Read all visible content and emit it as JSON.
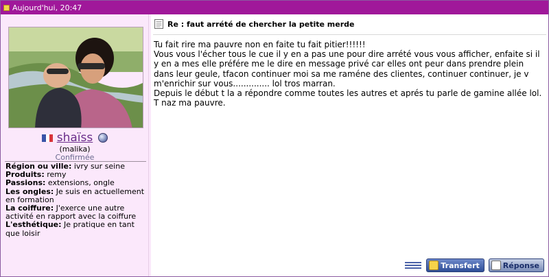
{
  "post": {
    "date": "Aujourd'hui, 20:47",
    "title": "Re : faut arrété de chercher la petite merde",
    "body": "Tu fait rire ma pauvre non en faite tu fait pitier!!!!!!\nVous vous l'écher tous le cue il y en a pas une pour dire arrété vous vous afficher, enfaite si il y en a mes elle préfére me le dire en message privé car elles ont peur dans prendre plein dans leur geule, tfacon continuer moi sa me raméne des clientes, continuer continuer, je v m'enrichir sur vous.............. lol tros marran.\nDepuis le début t la a répondre comme toutes les autres et aprés tu parle de gamine allée lol.\nT naz ma pauvre."
  },
  "author": {
    "username": "shaïss",
    "real_name": "(malika)",
    "rank": "Confirmée",
    "flag_icon": "france-flag-icon",
    "status_icon": "status-orb-icon",
    "fields": [
      {
        "label": "Région ou ville:",
        "value": " ivry sur seine"
      },
      {
        "label": "Produits:",
        "value": " remy"
      },
      {
        "label": "Passions:",
        "value": " extensions, ongle"
      },
      {
        "label": "Les ongles:",
        "value": " Je suis en actuellement en formation"
      },
      {
        "label": "La coiffure:",
        "value": " J'exerce une autre activité en rapport avec la coiffure"
      },
      {
        "label": "L'esthétique:",
        "value": " Je pratique en tant que loisir"
      }
    ]
  },
  "actions": {
    "transfer_label": "Transfert",
    "reply_label": "Réponse",
    "top_icon": "back-to-top-icon"
  },
  "colors": {
    "header_bg": "#a0189a",
    "sidebar_bg": "#fbe8fb",
    "username": "#6a2d8a",
    "rank": "#6b6b90"
  }
}
